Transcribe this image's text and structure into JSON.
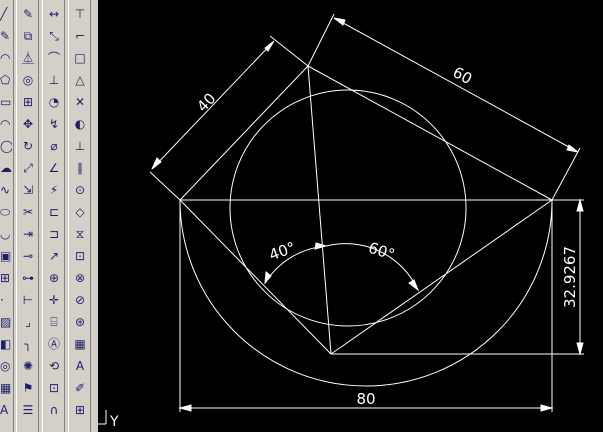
{
  "toolbar": {
    "col0": [
      "line-icon",
      "pencil-icon",
      "arc-icon",
      "polygon-icon",
      "rectangle-icon",
      "arc-icon",
      "circle-icon",
      "cloud-icon",
      "spline-icon",
      "ellipse-icon",
      "ellipse-arc-icon",
      "insert-block-icon",
      "make-block-icon",
      "point-icon",
      "hatch-icon",
      "gradient-icon",
      "region-icon",
      "table-icon",
      "text-icon"
    ],
    "col1": [
      "pencil-icon",
      "copy-icon",
      "mirror-icon",
      "offset-icon",
      "array-icon",
      "move-icon",
      "rotate-icon",
      "scale-icon",
      "stretch-icon",
      "trim-icon",
      "extend-icon",
      "break-point-icon",
      "break-icon",
      "join-icon",
      "chamfer-icon",
      "fillet-icon",
      "explode-icon",
      "match-properties-icon",
      "properties-icon"
    ],
    "col2": [
      "linear-dim-icon",
      "aligned-dim-icon",
      "arc-length-icon",
      "ordinate-dim-icon",
      "radius-dim-icon",
      "jogged-dim-icon",
      "diameter-dim-icon",
      "angular-dim-icon",
      "quick-dim-icon",
      "baseline-dim-icon",
      "continue-dim-icon",
      "leader-icon",
      "tolerance-icon",
      "center-mark-icon",
      "dim-edit-icon",
      "dim-text-edit-icon",
      "dim-update-icon",
      "dim-style-icon",
      "magnet-icon"
    ],
    "col3": [
      "vertical-dim-icon",
      "ortho-icon",
      "snap-endpoint-icon",
      "snap-midpoint-icon",
      "snap-intersection-icon",
      "snap-tangent-icon",
      "snap-perpendicular-icon",
      "snap-parallel-icon",
      "snap-center-icon",
      "snap-quadrant-icon",
      "snap-nearest-icon",
      "snap-insert-icon",
      "snap-node-icon",
      "snap-none-icon",
      "osnap-settings-icon",
      "grid-icon",
      "text-style-icon",
      "edit-icon",
      "extra-icon"
    ],
    "glyph_text": "A",
    "glyph_text_2": "A"
  },
  "drawing": {
    "dim_40": "40",
    "dim_60": "60",
    "dim_80": "80",
    "dim_vertical": "32.9267",
    "angle_40": "40°",
    "angle_60": "60°",
    "ucs_label": "Y",
    "line_color": "#ffffff",
    "background": "#000000"
  }
}
